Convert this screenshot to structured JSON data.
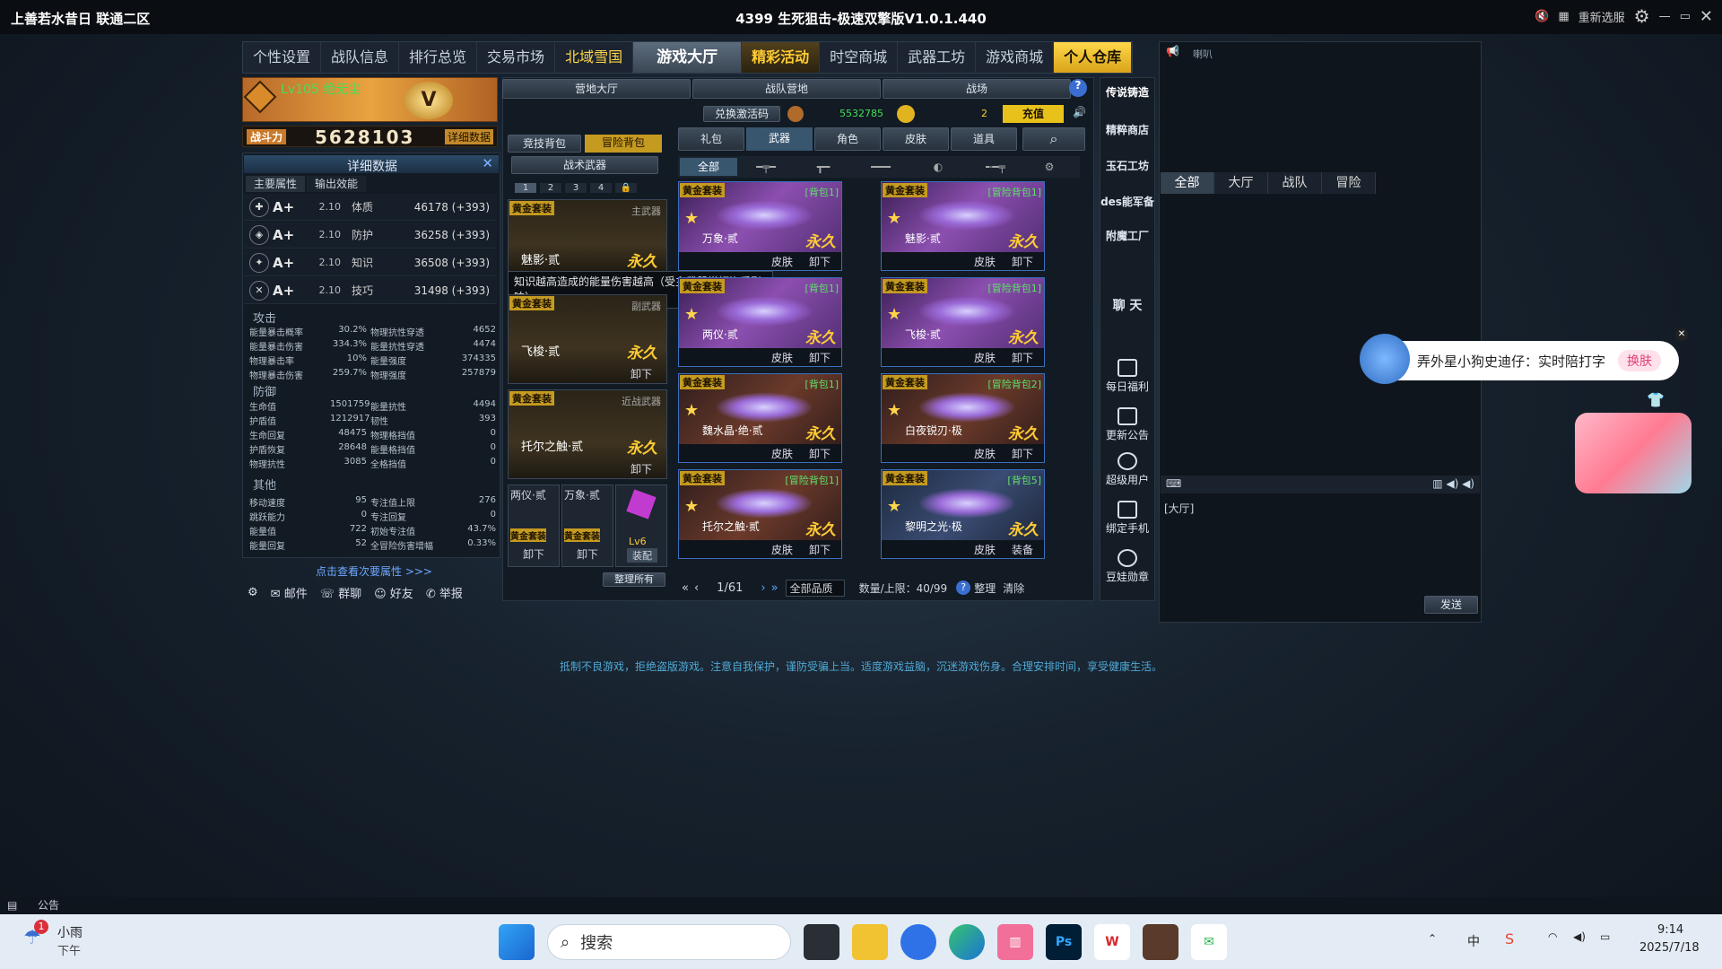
{
  "titlebar": {
    "left": "上善若水昔日 联通二区",
    "center": "4399 生死狙击-极速双擎版V1.0.1.440",
    "skin": "重新选服"
  },
  "nav": [
    "个性设置",
    "战队信息",
    "排行总览",
    "交易市场",
    "北域雪国",
    "游戏大厅",
    "精彩活动",
    "时空商城",
    "武器工坊",
    "游戏商城",
    "个人仓库"
  ],
  "player": {
    "level": "Lv105 绝无尘",
    "power_label": "战斗力",
    "power": "5628103",
    "detail_btn": "详细数据"
  },
  "detail": {
    "title": "详细数据",
    "tabs": [
      "主要属性",
      "输出效能"
    ],
    "stats": [
      {
        "icon": "plus-icon",
        "grade": "A+",
        "val": "2.10",
        "name": "体质",
        "num": "46178 (+393)"
      },
      {
        "icon": "shield-icon",
        "grade": "A+",
        "val": "2.10",
        "name": "防护",
        "num": "36258 (+393)"
      },
      {
        "icon": "wand-icon",
        "grade": "A+",
        "val": "2.10",
        "name": "知识",
        "num": "36508 (+393)"
      },
      {
        "icon": "sword-icon",
        "grade": "A+",
        "val": "2.10",
        "name": "技巧",
        "num": "31498 (+393)"
      }
    ],
    "attack_title": "攻击",
    "attack": [
      [
        "能量暴击概率",
        "30.2%",
        "物理抗性穿透",
        "4652"
      ],
      [
        "能量暴击伤害",
        "334.3%",
        "能量抗性穿透",
        "4474"
      ],
      [
        "物理暴击率",
        "10%",
        "能量强度",
        "374335"
      ],
      [
        "物理暴击伤害",
        "259.7%",
        "物理强度",
        "257879"
      ]
    ],
    "defense_title": "防御",
    "defense": [
      [
        "生命值",
        "1501759",
        "能量抗性",
        "4494"
      ],
      [
        "护盾值",
        "1212917",
        "韧性",
        "393"
      ],
      [
        "生命回复",
        "48475",
        "物理格挡值",
        "0"
      ],
      [
        "护盾恢复",
        "28648",
        "能量格挡值",
        "0"
      ],
      [
        "物理抗性",
        "3085",
        "全格挡值",
        "0"
      ]
    ],
    "other_title": "其他",
    "other": [
      [
        "移动速度",
        "95",
        "专注值上限",
        "276"
      ],
      [
        "跳跃能力",
        "0",
        "专注回复",
        "0"
      ],
      [
        "能量值",
        "722",
        "初始专注值",
        "43.7%"
      ],
      [
        "能量回复",
        "52",
        "全冒险伤害增幅",
        "0.33%"
      ]
    ],
    "more": "点击查看次要属性 >>>"
  },
  "bottombar": [
    "邮件",
    "群聊",
    "好友",
    "举报"
  ],
  "subnav": [
    "营地大厅",
    "战队营地",
    "战场"
  ],
  "bagtabs": [
    "竞技背包",
    "冒险背包"
  ],
  "tactical": "战术武器",
  "pages": [
    "1",
    "2",
    "3",
    "4"
  ],
  "tooltip": "知识越高造成的能量伤害越高（受主武器增幅资质影响）",
  "equipped": [
    {
      "tag": "黄金套装",
      "type": "主武器",
      "name": "魅影·贰",
      "perm": "永久",
      "btn": "卸下"
    },
    {
      "tag": "黄金套装",
      "type": "副武器",
      "name": "飞梭·贰",
      "perm": "永久",
      "btn": "卸下"
    },
    {
      "tag": "黄金套装",
      "type": "近战武器",
      "name": "托尔之触·贰",
      "perm": "永久",
      "btn": "卸下"
    }
  ],
  "small": [
    {
      "name": "两仪·贰",
      "tag": "黄金套装",
      "btn": "卸下"
    },
    {
      "name": "万象·贰",
      "tag": "黄金套装",
      "btn": "卸下"
    },
    {
      "level": "Lv6",
      "btn": "装配"
    }
  ],
  "sort_btn": "整理所有",
  "currency": {
    "redeem": "兑换激活码",
    "gold": "5532785",
    "coin": "2",
    "charge": "充值"
  },
  "cats": [
    "礼包",
    "武器",
    "角色",
    "皮肤",
    "道具"
  ],
  "filters": [
    "全部"
  ],
  "items": [
    {
      "tag": "黄金套装",
      "bag": "[背包1]",
      "name": "万象·贰",
      "perm": "永久",
      "b1": "皮肤",
      "b2": "卸下",
      "style": ""
    },
    {
      "tag": "黄金套装",
      "bag": "[冒险背包1]",
      "name": "魅影·贰",
      "perm": "永久",
      "b1": "皮肤",
      "b2": "卸下",
      "style": ""
    },
    {
      "tag": "黄金套装",
      "bag": "[背包1]",
      "name": "两仪·贰",
      "perm": "永久",
      "b1": "皮肤",
      "b2": "卸下",
      "style": ""
    },
    {
      "tag": "黄金套装",
      "bag": "[冒险背包1]",
      "name": "飞梭·贰",
      "perm": "永久",
      "b1": "皮肤",
      "b2": "卸下",
      "style": ""
    },
    {
      "tag": "黄金套装",
      "bag": "[背包1]",
      "name": "魏水晶·绝·贰",
      "perm": "永久",
      "b1": "皮肤",
      "b2": "卸下",
      "style": "alt"
    },
    {
      "tag": "黄金套装",
      "bag": "[冒险背包2]",
      "name": "白夜锐刃·极",
      "perm": "永久",
      "b1": "皮肤",
      "b2": "卸下",
      "style": "alt"
    },
    {
      "tag": "黄金套装",
      "bag": "[冒险背包1]",
      "name": "托尔之触·贰",
      "perm": "永久",
      "b1": "皮肤",
      "b2": "卸下",
      "style": "alt"
    },
    {
      "tag": "黄金套装",
      "bag": "[背包5]",
      "name": "黎明之光·极",
      "perm": "永久",
      "b1": "皮肤",
      "b2": "装备",
      "style": "blue"
    }
  ],
  "pager": {
    "page": "1/61",
    "quality": "全部品质",
    "cap": "数量/上限：40/99",
    "sort": "整理",
    "clear": "清除"
  },
  "rightside": [
    "传说铸造",
    "精粹商店",
    "玉石工坊",
    "des能军备",
    "附魔工厂"
  ],
  "chat_label": "聊 天",
  "side_items": [
    "每日福利",
    "更新公告",
    "超级用户",
    "绑定手机",
    "豆娃勋章"
  ],
  "chat": {
    "tabs": [
      "全部",
      "大厅",
      "战队",
      "冒险"
    ],
    "channel": "[大厅]",
    "send": "发送",
    "top": "喇叭"
  },
  "float": {
    "text": "弄外星小狗史迪仔：实时陪打字",
    "btn": "换肤"
  },
  "notice_text": "抵制不良游戏，拒绝盗版游戏。注意自我保护，谨防受骗上当。适度游戏益脑，沉迷游戏伤身。合理安排时间，享受健康生活。",
  "bulletin": "公告",
  "taskbar": {
    "weather": "小雨",
    "period": "下午",
    "badge": "1",
    "search": "搜索",
    "ime": "中",
    "time": "9:14",
    "date": "2025/7/18"
  }
}
